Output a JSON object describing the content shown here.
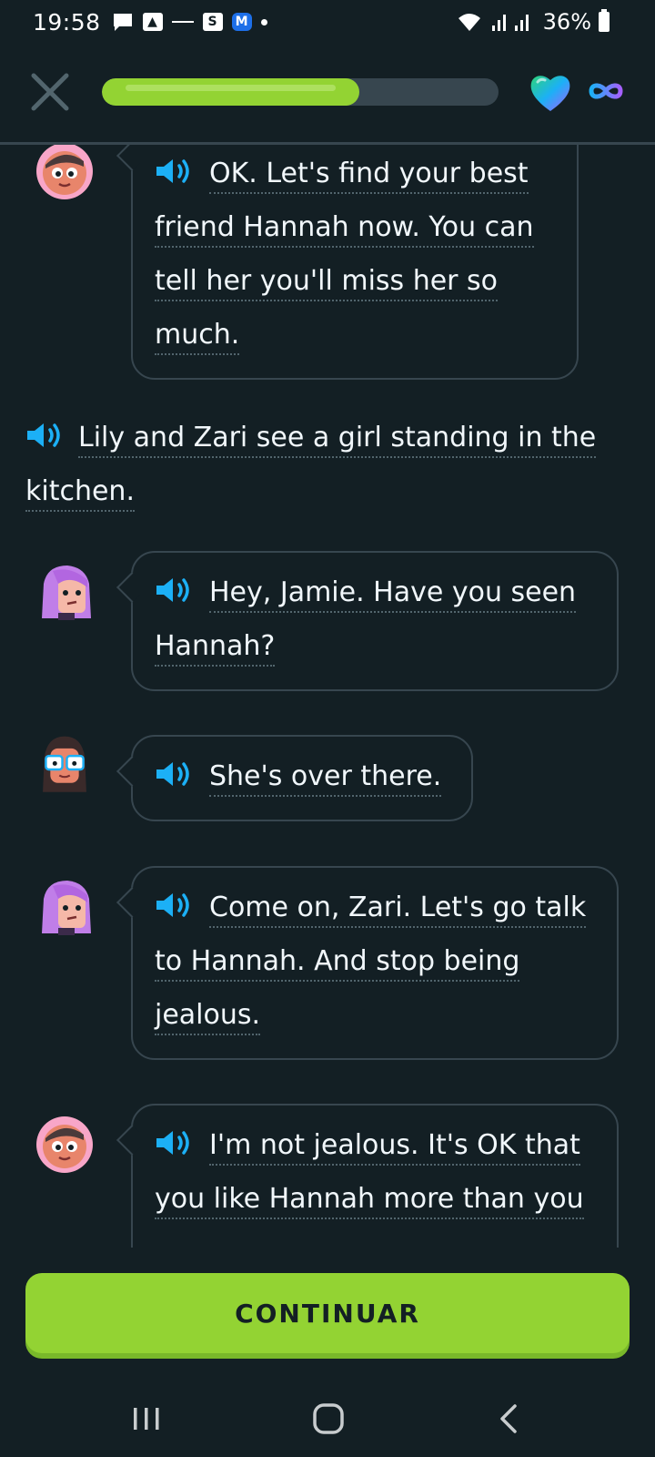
{
  "status_bar": {
    "time": "19:58",
    "battery": "36%",
    "icons": [
      "message-icon",
      "app-icon",
      "notification-icon",
      "s-icon",
      "m-icon",
      "dot-icon",
      "wifi-icon",
      "signal-icon",
      "battery-icon"
    ]
  },
  "header": {
    "progress": 0.65,
    "progress_color": "#93d333",
    "hearts": "infinity"
  },
  "messages": [
    {
      "speaker_avatar": "zari-avatar",
      "lines": [
        "OK. Let's find your best",
        "friend Hannah now. You can",
        "tell her you'll miss her so",
        "much."
      ]
    },
    {
      "narration": true,
      "lines": [
        "Lily and Zari see a girl standing in the",
        "kitchen."
      ]
    },
    {
      "speaker_avatar": "lily-avatar",
      "lines": [
        "Hey, Jamie. Have you seen",
        "Hannah?"
      ]
    },
    {
      "speaker_avatar": "jamie-avatar",
      "lines": [
        "She's over there."
      ]
    },
    {
      "speaker_avatar": "lily-avatar",
      "lines": [
        "Come on, Zari. Let's go talk",
        "to Hannah. And stop being",
        "jealous."
      ]
    },
    {
      "speaker_avatar": "zari-avatar",
      "lines": [
        "I'm not jealous. It's OK that",
        "you like Hannah more than you"
      ]
    }
  ],
  "continue_button": {
    "label": "CONTINUAR"
  },
  "colors": {
    "background": "#131f24",
    "border": "#37464f",
    "accent_green": "#93d333",
    "speaker_blue": "#1cb0f6"
  }
}
